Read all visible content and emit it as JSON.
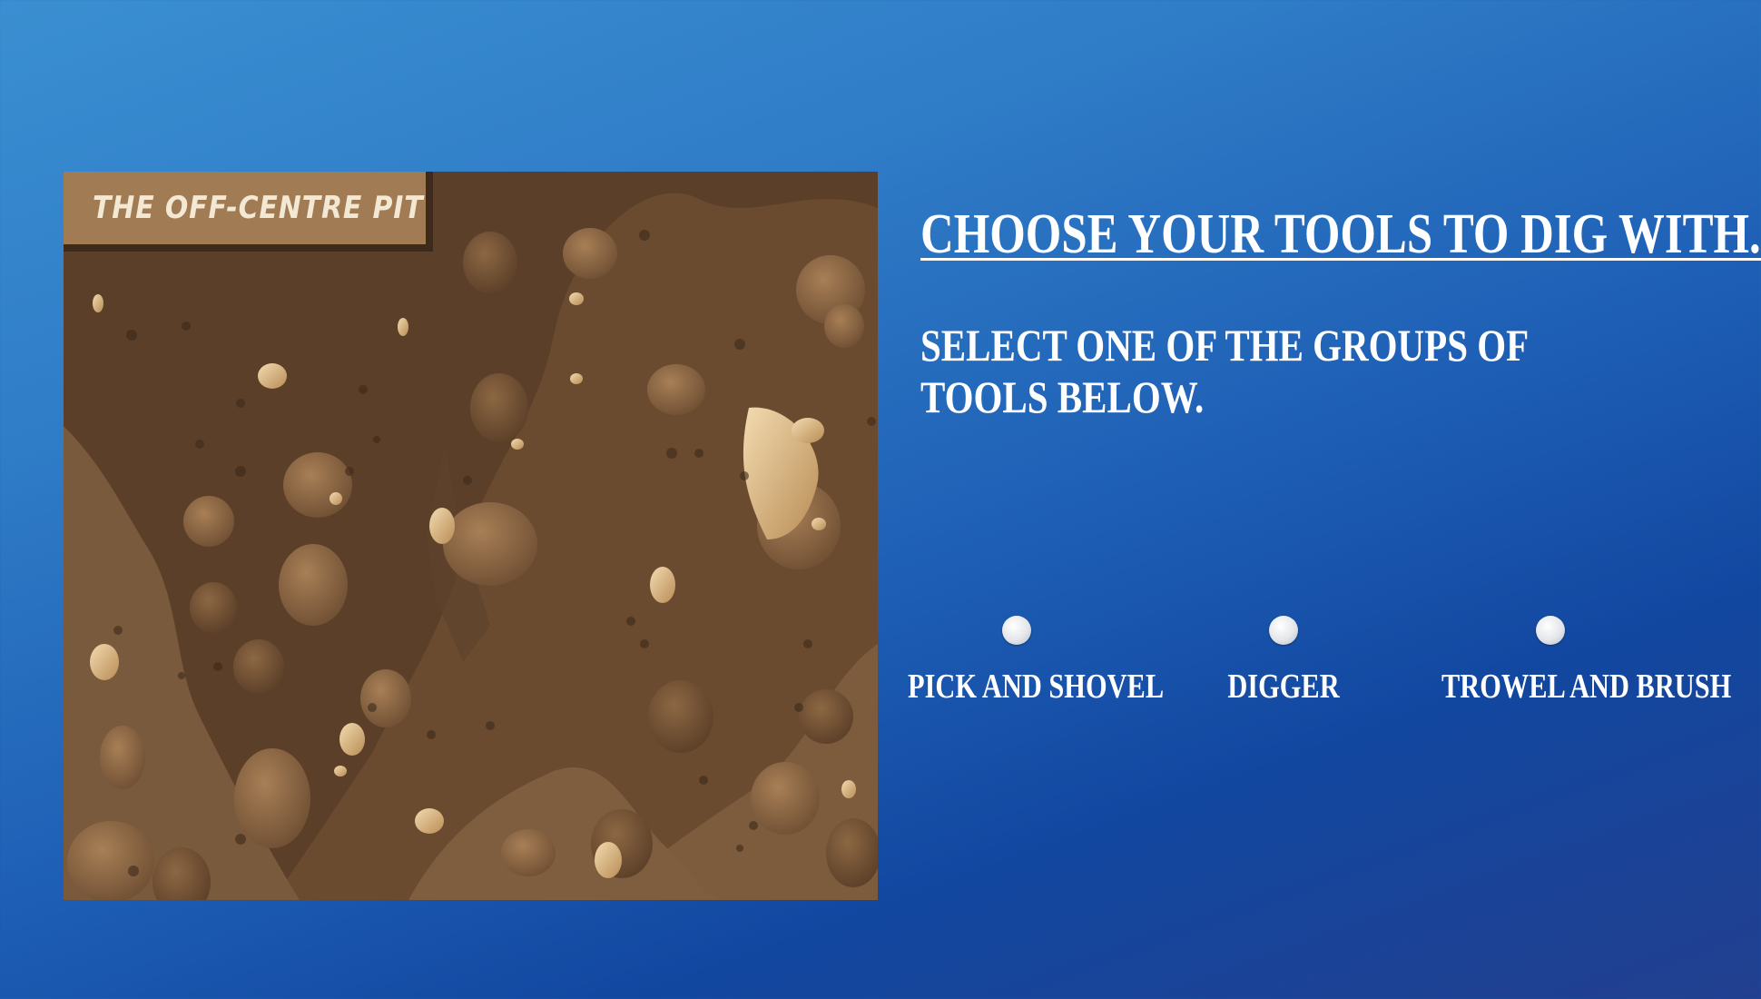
{
  "pit": {
    "label": "THE OFF-CENTRE PIT"
  },
  "heading": "CHOOSE YOUR TOOLS TO DIG WITH...",
  "instruction": "SELECT ONE OF THE GROUPS OF TOOLS BELOW.",
  "tool_groups": [
    {
      "label": "PICK AND SHOVEL",
      "selected": false
    },
    {
      "label": "DIGGER",
      "selected": false
    },
    {
      "label": "TROWEL AND BRUSH",
      "selected": false
    }
  ],
  "colors": {
    "background_top_left": "#3a8fd1",
    "background_bottom_right": "#223f8f",
    "soil": "#6b4d32",
    "label_bg": "#a07b54",
    "text": "#ffffff"
  }
}
